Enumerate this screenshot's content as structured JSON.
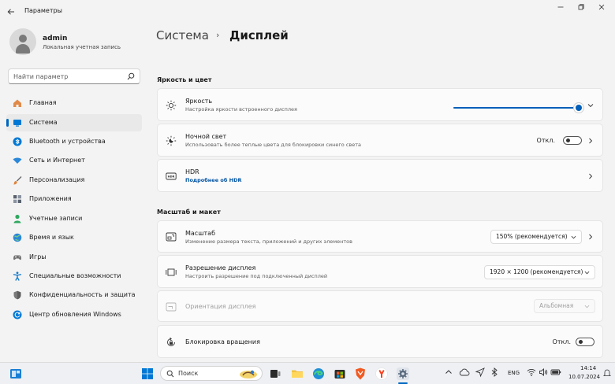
{
  "window": {
    "title": "Параметры",
    "controls": [
      "minimize-icon",
      "maximize-icon",
      "close-icon"
    ]
  },
  "user": {
    "name": "admin",
    "account_type": "Локальная учетная запись"
  },
  "search": {
    "placeholder": "Найти параметр"
  },
  "sidebar": {
    "items": [
      {
        "label": "Главная",
        "icon": "home-icon",
        "color": "#d87b3c"
      },
      {
        "label": "Система",
        "icon": "system-icon",
        "color": "#0078d4",
        "selected": true
      },
      {
        "label": "Bluetooth и устройства",
        "icon": "bluetooth-icon",
        "color": "#0078d4"
      },
      {
        "label": "Сеть и Интернет",
        "icon": "wifi-icon",
        "color": "#2b88d8"
      },
      {
        "label": "Персонализация",
        "icon": "brush-icon",
        "color": "#c8732c"
      },
      {
        "label": "Приложения",
        "icon": "apps-icon",
        "color": "#5a6270"
      },
      {
        "label": "Учетные записи",
        "icon": "person-icon",
        "color": "#2fa860"
      },
      {
        "label": "Время и язык",
        "icon": "globe-icon",
        "color": "#2b88d8"
      },
      {
        "label": "Игры",
        "icon": "gamepad-icon",
        "color": "#6b6b6b"
      },
      {
        "label": "Специальные возможности",
        "icon": "accessibility-icon",
        "color": "#1479c9"
      },
      {
        "label": "Конфиденциальность и защита",
        "icon": "shield-icon",
        "color": "#6b6b6b"
      },
      {
        "label": "Центр обновления Windows",
        "icon": "update-icon",
        "color": "#0078d4"
      }
    ]
  },
  "breadcrumb": {
    "parent": "Система",
    "separator": "›",
    "current": "Дисплей"
  },
  "sections": {
    "brightness_color": "Яркость и цвет",
    "scale_layout": "Масштаб и макет"
  },
  "settings": {
    "brightness": {
      "title": "Яркость",
      "subtitle": "Настройка яркости встроенного дисплея",
      "value_percent": 98,
      "icon": "sun-icon"
    },
    "night_light": {
      "title": "Ночной свет",
      "subtitle": "Использовать более теплые цвета для блокировки синего света",
      "state": "Откл.",
      "icon": "night-sun-icon"
    },
    "hdr": {
      "title": "HDR",
      "link": "Подробнее об HDR",
      "icon": "hdr-icon"
    },
    "scale": {
      "title": "Масштаб",
      "subtitle": "Изменение размера текста, приложений и других элементов",
      "value": "150% (рекомендуется)",
      "icon": "scale-icon"
    },
    "resolution": {
      "title": "Разрешение дисплея",
      "subtitle": "Настроить разрешение под подключенный дисплей",
      "value": "1920 × 1200 (рекомендуется)",
      "icon": "resolution-icon"
    },
    "orientation": {
      "title": "Ориентация дисплея",
      "value": "Альбомная",
      "icon": "orientation-icon",
      "disabled": true
    },
    "rotation_lock": {
      "title": "Блокировка вращения",
      "state": "Откл.",
      "icon": "rotation-lock-icon"
    }
  },
  "taskbar": {
    "search_label": "Поиск",
    "language": "ENG",
    "time": "14:14",
    "date": "10.07.2024"
  },
  "colors": {
    "accent": "#0067c0",
    "background": "#f3f3f3",
    "card": "#fbfbfb"
  }
}
